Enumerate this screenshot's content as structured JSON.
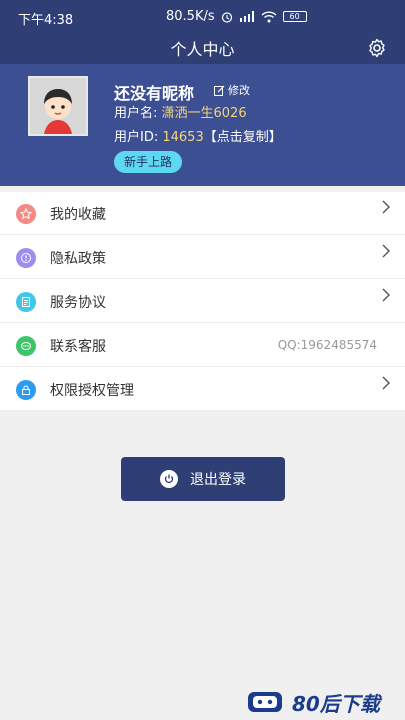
{
  "statusbar": {
    "time": "下午4:38",
    "speed": "80.5K/s",
    "battery": "60"
  },
  "header": {
    "title": "个人中心",
    "settings_icon": "gear-icon"
  },
  "profile": {
    "nickname": "还没有昵称",
    "edit_label": "修改",
    "username_label": "用户名: ",
    "username_value": "潇洒一生6026",
    "userid_label": "用户ID: ",
    "userid_value": "14653",
    "copy_label": "【点击复制】",
    "badge": "新手上路"
  },
  "menu": {
    "items": [
      {
        "label": "我的收藏",
        "icon": "star-icon",
        "color": "#f38a86",
        "extra": ""
      },
      {
        "label": "隐私政策",
        "icon": "privacy-icon",
        "color": "#9b8ef0",
        "extra": ""
      },
      {
        "label": "服务协议",
        "icon": "document-icon",
        "color": "#42c6e8",
        "extra": ""
      },
      {
        "label": "联系客服",
        "icon": "customer-service-icon",
        "color": "#40c46b",
        "extra": "QQ:1962485574"
      },
      {
        "label": "权限授权管理",
        "icon": "lock-icon",
        "color": "#2d9bf0",
        "extra": ""
      }
    ]
  },
  "logout": {
    "label": "退出登录"
  },
  "watermark": {
    "text": "80后下载"
  },
  "colors": {
    "header_bg": "#2f3f76",
    "profile_bg": "#3c4f92",
    "accent_badge": "#5ed8f2",
    "highlight_text": "#f5d37a"
  }
}
